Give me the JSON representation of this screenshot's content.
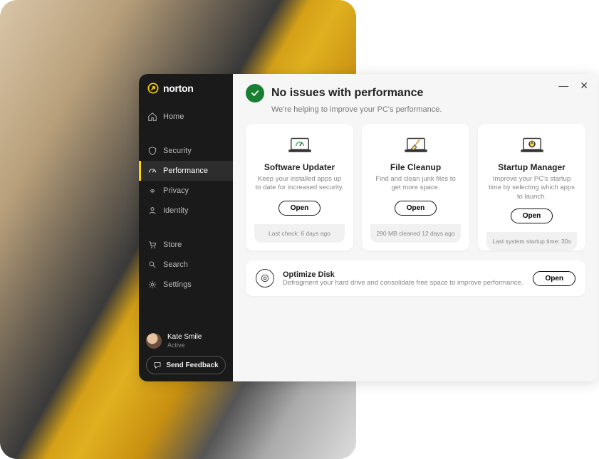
{
  "brand": {
    "name": "norton"
  },
  "sidebar": {
    "groups": [
      [
        {
          "icon": "home-icon",
          "label": "Home"
        }
      ],
      [
        {
          "icon": "shield-icon",
          "label": "Security"
        },
        {
          "icon": "gauge-icon",
          "label": "Performance",
          "active": true
        },
        {
          "icon": "fingerprint-icon",
          "label": "Privacy"
        },
        {
          "icon": "person-icon",
          "label": "Identity"
        }
      ],
      [
        {
          "icon": "cart-icon",
          "label": "Store"
        },
        {
          "icon": "search-icon",
          "label": "Search"
        },
        {
          "icon": "gear-icon",
          "label": "Settings"
        }
      ]
    ],
    "user": {
      "name": "Kate Smile",
      "status": "Active"
    },
    "feedback_label": "Send Feedback"
  },
  "main": {
    "title": "No issues with performance",
    "subtitle": "We're helping to improve your PC's performance.",
    "cards": [
      {
        "title": "Software Updater",
        "desc": "Keep your installed apps up to date for increased security.",
        "button": "Open",
        "footer": "Last check: 6 days ago"
      },
      {
        "title": "File Cleanup",
        "desc": "Find and clean junk files to get more space.",
        "button": "Open",
        "footer": "290 MB cleaned 12 days ago"
      },
      {
        "title": "Startup Manager",
        "desc": "Improve your PC's startup time by selecting which apps to launch.",
        "button": "Open",
        "footer": "Last system startup time: 30s"
      }
    ],
    "row": {
      "title": "Optimize Disk",
      "desc": "Defragment your hard drive and consolidate free space to improve performance.",
      "button": "Open"
    }
  }
}
